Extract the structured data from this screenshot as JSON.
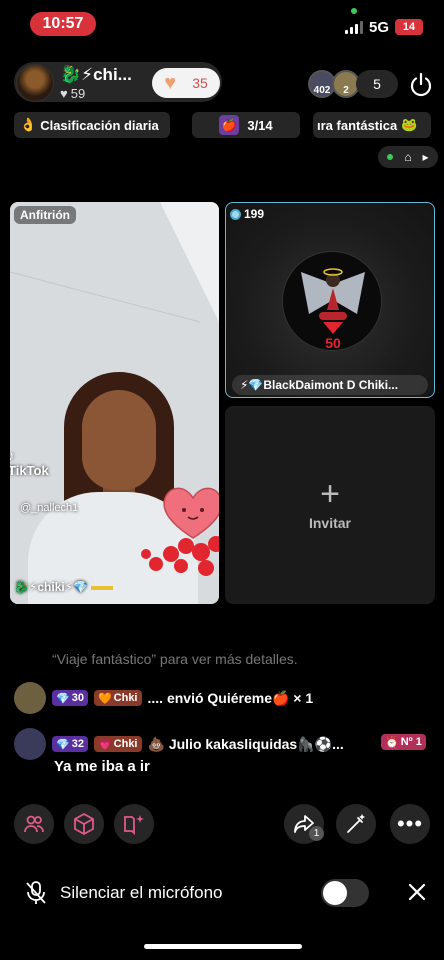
{
  "status_bar": {
    "time": "10:57",
    "network": "5G",
    "battery": "14"
  },
  "host": {
    "name": "🐉⚡chi...",
    "likes": "59",
    "heart_count": "35"
  },
  "viewers": {
    "badges": [
      "402",
      "2"
    ],
    "count": "5"
  },
  "chips": {
    "daily_ranking": "Clasificación diaria",
    "progress": "3/14",
    "fantastic": "ıra fantástica"
  },
  "panels": {
    "host_tag": "Anfitrión",
    "tiktok_logo": "TikTok",
    "tiktok_user": "@_nallech1",
    "host_label": "🐉⚡chiki⚡💎",
    "guest_coins": "199",
    "guest_name": "⚡💎BlackDaimont D Chiki...",
    "guest_badge_number": "50",
    "invite_label": "Invitar"
  },
  "chat": {
    "faded_hint": "“Viaje fantástico” para ver más detalles.",
    "messages": [
      {
        "level": "30",
        "club": "Chki",
        "text": ".... envió Quiéreme🍎 × 1"
      },
      {
        "level": "32",
        "club": "Chki",
        "user": "💩 Julio kakasliquidas🦍⚽...",
        "rank": "Nº 1",
        "text": "Ya me iba a ir"
      }
    ]
  },
  "toolbar": {
    "share_count": "1"
  },
  "mute": {
    "label": "Silenciar el micrófono",
    "enabled": false
  },
  "colors": {
    "accent_red": "#d8323a",
    "guest_border": "#6ab8d8",
    "level_badge": "#5a2fa0"
  }
}
